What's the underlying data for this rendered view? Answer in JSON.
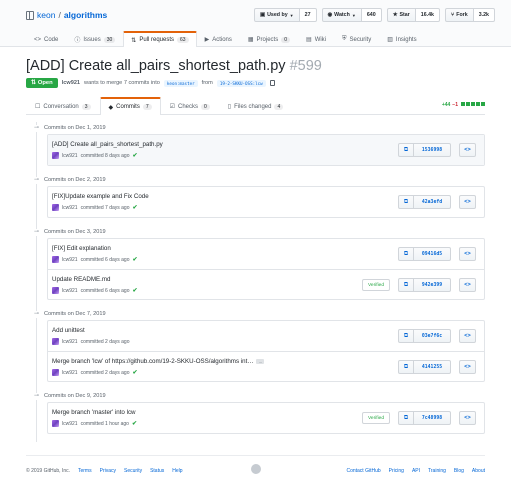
{
  "repo": {
    "owner": "keon",
    "separator": "/",
    "name": "algorithms"
  },
  "actions": {
    "used_by": {
      "label": "Used by",
      "count": "27"
    },
    "watch": {
      "label": "Watch",
      "count": "640"
    },
    "star": {
      "label": "Star",
      "count": "16.4k"
    },
    "fork": {
      "label": "Fork",
      "count": "3.2k"
    }
  },
  "reponav": [
    {
      "label": "Code",
      "icon": "<>",
      "counter": ""
    },
    {
      "label": "Issues",
      "icon": "ⓘ",
      "counter": "30"
    },
    {
      "label": "Pull requests",
      "icon": "⇅",
      "counter": "63"
    },
    {
      "label": "Actions",
      "icon": "▶",
      "counter": ""
    },
    {
      "label": "Projects",
      "icon": "▦",
      "counter": "0"
    },
    {
      "label": "Wiki",
      "icon": "▤",
      "counter": ""
    },
    {
      "label": "Security",
      "icon": "⛨",
      "counter": ""
    },
    {
      "label": "Insights",
      "icon": "▥",
      "counter": ""
    }
  ],
  "pr": {
    "title": "[ADD] Create all_pairs_shortest_path.py",
    "number": "#599",
    "state": "Open",
    "author": "lcw921",
    "meta_text": "wants to merge 7 commits into",
    "base_branch": "keon:master",
    "from_text": "from",
    "head_branch": "19-2-SKKU-OSS:lcw"
  },
  "pr_tabs": [
    {
      "label": "Conversation",
      "icon": "☐",
      "counter": "3"
    },
    {
      "label": "Commits",
      "icon": "◆",
      "counter": "7"
    },
    {
      "label": "Checks",
      "icon": "☑",
      "counter": "0"
    },
    {
      "label": "Files changed",
      "icon": "▯",
      "counter": "4"
    }
  ],
  "diffstat": {
    "additions": "+44",
    "deletions": "−1"
  },
  "colors": {
    "open": "#28a745",
    "link": "#0366d6",
    "selected_tab": "#e36209"
  },
  "commit_groups": [
    {
      "date": "Commits on Dec 1, 2019",
      "commits": [
        {
          "title": "[ADD] Create all_pairs_shortest_path.py",
          "author": "lcw921",
          "time": "committed 8 days ago",
          "check": true,
          "verified": "",
          "sha": "1536998",
          "highlight": true
        }
      ]
    },
    {
      "date": "Commits on Dec 2, 2019",
      "commits": [
        {
          "title": "[FIX]Update example and Fix Code",
          "author": "lcw921",
          "time": "committed 7 days ago",
          "check": true,
          "verified": "",
          "sha": "42a3efd",
          "highlight": false
        }
      ]
    },
    {
      "date": "Commits on Dec 3, 2019",
      "commits": [
        {
          "title": "[FIX] Edit explanation",
          "author": "lcw921",
          "time": "committed 6 days ago",
          "check": true,
          "verified": "",
          "sha": "09416d5",
          "highlight": false
        },
        {
          "title": "Update README.md",
          "author": "lcw921",
          "time": "committed 6 days ago",
          "check": true,
          "verified": "Verified",
          "sha": "942e399",
          "highlight": false
        }
      ]
    },
    {
      "date": "Commits on Dec 7, 2019",
      "commits": [
        {
          "title": "Add unittest",
          "author": "lcw921",
          "time": "committed 2 days ago",
          "check": false,
          "verified": "",
          "sha": "03e7f6c",
          "highlight": false
        },
        {
          "title": "Merge branch 'lcw' of https://github.com/19-2-SKKU-OSS/algorithms int…",
          "author": "lcw921",
          "time": "committed 2 days ago",
          "check": true,
          "verified": "",
          "sha": "4141255",
          "highlight": false,
          "ellipsis": "…"
        }
      ]
    },
    {
      "date": "Commits on Dec 9, 2019",
      "commits": [
        {
          "title": "Merge branch 'master' into lcw",
          "author": "lcw921",
          "time": "committed 1 hour ago",
          "check": true,
          "verified": "Verified",
          "sha": "7c48998",
          "highlight": false
        }
      ]
    }
  ],
  "footer": {
    "copyright": "© 2019 GitHub, Inc.",
    "left_links": [
      "Terms",
      "Privacy",
      "Security",
      "Status",
      "Help"
    ],
    "right_links": [
      "Contact GitHub",
      "Pricing",
      "API",
      "Training",
      "Blog",
      "About"
    ]
  }
}
